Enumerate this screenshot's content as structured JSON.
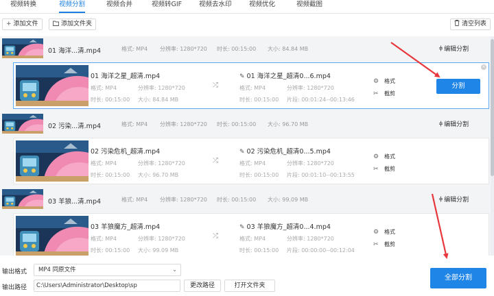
{
  "tabs": [
    "视频转换",
    "视频分割",
    "视频合并",
    "视频转GIF",
    "视频去水印",
    "视频优化",
    "视频截图"
  ],
  "active_tab": 1,
  "toolbar": {
    "add_file": "添加文件",
    "add_folder": "添加文件夹",
    "clear_list": "清空列表"
  },
  "labels": {
    "format": "格式:",
    "resolution": "分辨率:",
    "duration": "时长:",
    "size": "大小:",
    "clip": "片段:",
    "edit_split": "编辑分割",
    "act_format": "格式",
    "act_cut": "截剪",
    "split": "分割"
  },
  "files": [
    {
      "header": {
        "title": "01 海洋...清.mp4",
        "format": "MP4",
        "resolution": "1280*720",
        "duration": "00:15:00",
        "size": "84.84 MB"
      },
      "source": {
        "name": "01 海洋之星_超清.mp4",
        "format": "MP4",
        "resolution": "1280*720",
        "duration": "00:15:00",
        "size": "84.84 MB"
      },
      "output": {
        "name": "01 海洋之星_超清0...6.mp4",
        "format": "MP4",
        "resolution": "1280*720",
        "duration": "00:15:00",
        "clip": "00:01:24--00:13:46"
      },
      "selected": true
    },
    {
      "header": {
        "title": "02 污染...清.mp4",
        "format": "MP4",
        "resolution": "1280*720",
        "duration": "00:15:00",
        "size": "96.70 MB"
      },
      "source": {
        "name": "02 污染危机_超清.mp4",
        "format": "MP4",
        "resolution": "1280*720",
        "duration": "00:15:00",
        "size": "96.70 MB"
      },
      "output": {
        "name": "02 污染危机_超清0...5.mp4",
        "format": "MP4",
        "resolution": "1280*720",
        "duration": "00:15:00",
        "clip": "00:01:10--00:13:55"
      },
      "selected": false
    },
    {
      "header": {
        "title": "03 羊狼...清.mp4",
        "format": "MP4",
        "resolution": "1280*720",
        "duration": "00:15:00",
        "size": "99.09 MB"
      },
      "source": {
        "name": "03 羊狼魔方_超清.mp4",
        "format": "MP4",
        "resolution": "1280*720",
        "duration": "00:15:00",
        "size": "99.09 MB"
      },
      "output": {
        "name": "03 羊狼魔方_超清0...4.mp4",
        "format": "MP4",
        "resolution": "1280*720",
        "duration": "00:15:00",
        "clip": "00:00:00--00:12:04"
      },
      "selected": false
    }
  ],
  "bottom": {
    "output_format_label": "输出格式",
    "output_format_value": "MP4  同原文件",
    "output_path_label": "输出路径",
    "output_path_value": "C:\\Users\\Administrator\\Desktop\\sp",
    "change_path": "更改路径",
    "open_folder": "打开文件夹",
    "split_all": "全部分割"
  },
  "colors": {
    "accent": "#1f85e6",
    "arrow": "#e8373c"
  }
}
